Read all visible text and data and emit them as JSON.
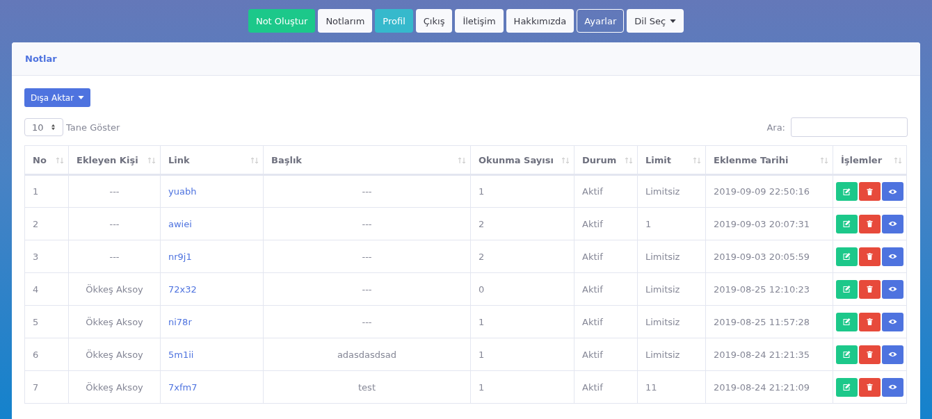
{
  "nav": [
    {
      "label": "Not Oluştur",
      "kind": "success"
    },
    {
      "label": "Notlarım",
      "kind": "light"
    },
    {
      "label": "Profil",
      "kind": "info"
    },
    {
      "label": "Çıkış",
      "kind": "light"
    },
    {
      "label": "İletişim",
      "kind": "light"
    },
    {
      "label": "Hakkımızda",
      "kind": "light"
    },
    {
      "label": "Ayarlar",
      "kind": "outline"
    },
    {
      "label": "Dil Seç",
      "kind": "dropdown"
    }
  ],
  "card": {
    "title": "Notlar",
    "export_button": "Dışa Aktar",
    "page_size": "10",
    "page_size_label": "Tane Göster",
    "search_label": "Ara:"
  },
  "table": {
    "columns": [
      "No",
      "Ekleyen Kişi",
      "Link",
      "Başlık",
      "Okunma Sayısı",
      "Durum",
      "Limit",
      "Eklenme Tarihi",
      "İşlemler"
    ],
    "rows": [
      [
        "1",
        "---",
        "yuabh",
        "---",
        "1",
        "Aktif",
        "Limitsiz",
        "2019-09-09 22:50:16"
      ],
      [
        "2",
        "---",
        "awiei",
        "---",
        "2",
        "Aktif",
        "1",
        "2019-09-03 20:07:31"
      ],
      [
        "3",
        "---",
        "nr9j1",
        "---",
        "2",
        "Aktif",
        "Limitsiz",
        "2019-09-03 20:05:59"
      ],
      [
        "4",
        "Ökkeş Aksoy",
        "72x32",
        "---",
        "0",
        "Aktif",
        "Limitsiz",
        "2019-08-25 12:10:23"
      ],
      [
        "5",
        "Ökkeş Aksoy",
        "ni78r",
        "---",
        "1",
        "Aktif",
        "Limitsiz",
        "2019-08-25 11:57:28"
      ],
      [
        "6",
        "Ökkeş Aksoy",
        "5m1ii",
        "adasdasdsad",
        "1",
        "Aktif",
        "Limitsiz",
        "2019-08-24 21:21:35"
      ],
      [
        "7",
        "Ökkeş Aksoy",
        "7xfm7",
        "test",
        "1",
        "Aktif",
        "11",
        "2019-08-24 21:21:09"
      ]
    ]
  }
}
